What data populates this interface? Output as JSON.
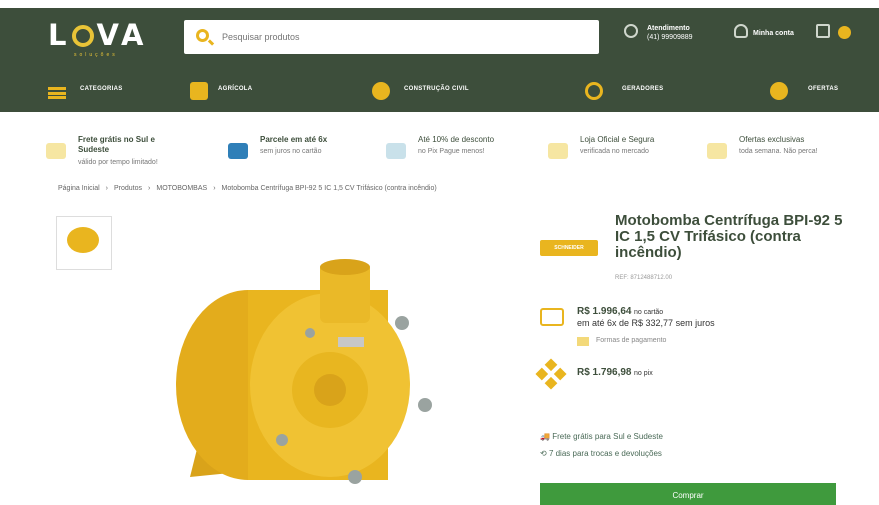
{
  "header": {
    "logo": "L⚙VA",
    "logo_sub": "soluções",
    "search_placeholder": "Pesquisar produtos",
    "service_label": "Atendimento",
    "service_phone": "(41) 99909889",
    "account_label": "Minha conta"
  },
  "nav": {
    "categories": "CATEGORIAS",
    "agricola": "AGRÍCOLA",
    "construcao": "CONSTRUÇÃO CIVIL",
    "geradores": "GERADORES",
    "ofertas": "OFERTAS"
  },
  "benefits": [
    {
      "title": "Frete grátis no Sul e Sudeste",
      "sub": "válido por tempo limitado!"
    },
    {
      "title": "Parcele em até 6x",
      "sub": "sem juros no cartão"
    },
    {
      "title": "Até 10% de desconto",
      "sub": "no Pix Pague menos!"
    },
    {
      "title": "Loja Oficial e Segura",
      "sub": "verificada no mercado"
    },
    {
      "title": "Ofertas exclusivas",
      "sub": "toda semana. Não perca!"
    }
  ],
  "breadcrumb": {
    "home": "Página Inicial",
    "products": "Produtos",
    "category": "MOTOBOMBAS",
    "current": "Motobomba Centrífuga BPI-92 5 IC 1,5 CV Trifásico (contra incêndio)",
    "sep": "›"
  },
  "product": {
    "brand": "SCHNEIDER",
    "title": "Motobomba Centrífuga BPI-92 5 IC 1,5 CV Trifásico (contra incêndio)",
    "sku": "REF: 8712488712.00",
    "card_price": "R$ 1.996,64",
    "card_suffix": "no cartão",
    "installments": "em até 6x de R$ 332,77 sem juros",
    "payment_link": "Formas de pagamento",
    "pix_price": "R$ 1.796,98",
    "pix_suffix": "no pix",
    "shipping": "Frete grátis para Sul e Sudeste",
    "returns": "7 dias para trocas e devoluções",
    "buy": "Comprar"
  },
  "colors": {
    "header": "#3d4e3b",
    "accent": "#e9b51f",
    "buy": "#3f9a3d"
  }
}
